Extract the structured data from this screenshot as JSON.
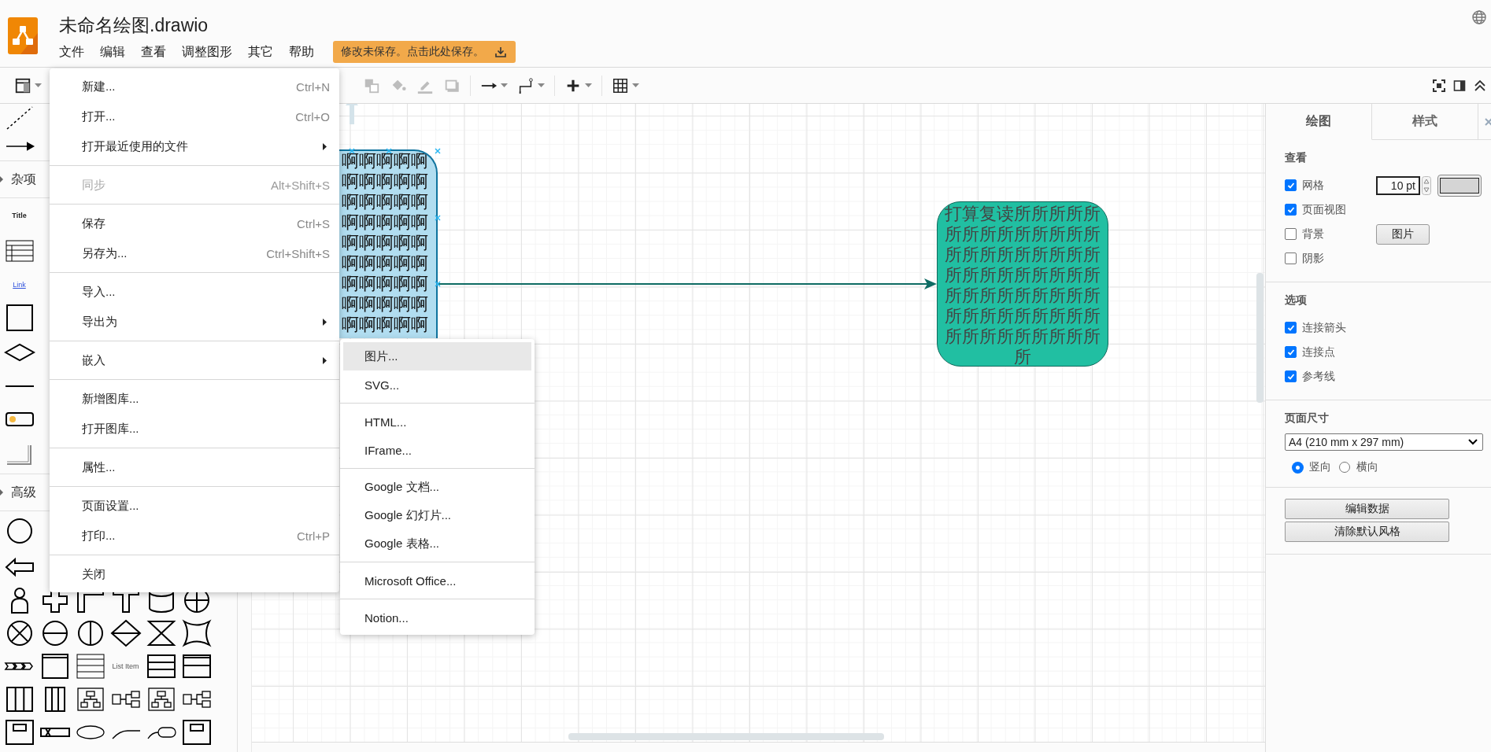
{
  "header": {
    "title": "未命名绘图.drawio",
    "menus": [
      "文件",
      "编辑",
      "查看",
      "调整图形",
      "其它",
      "帮助"
    ],
    "save_notice": "修改未保存。点击此处保存。"
  },
  "toolbar": [
    {
      "kind": "layout",
      "disabled": false
    },
    {
      "kind": "to-back",
      "disabled": true
    },
    {
      "kind": "fill",
      "disabled": true
    },
    {
      "kind": "line-color",
      "disabled": true
    },
    {
      "kind": "shadow",
      "disabled": true
    },
    {
      "kind": "separator"
    },
    {
      "kind": "connection",
      "disabled": false
    },
    {
      "kind": "waypoints",
      "disabled": false
    },
    {
      "kind": "separator"
    },
    {
      "kind": "insert",
      "disabled": false
    },
    {
      "kind": "separator"
    },
    {
      "kind": "table",
      "disabled": false
    }
  ],
  "file_menu": [
    {
      "kind": "item",
      "label": "新建...",
      "shortcut": "Ctrl+N",
      "disabled": false,
      "submenu": false
    },
    {
      "kind": "item",
      "label": "打开...",
      "shortcut": "Ctrl+O",
      "disabled": false,
      "submenu": false
    },
    {
      "kind": "item",
      "label": "打开最近使用的文件",
      "disabled": false,
      "submenu": true
    },
    {
      "kind": "separator"
    },
    {
      "kind": "item",
      "label": "同步",
      "shortcut": "Alt+Shift+S",
      "disabled": true,
      "submenu": false
    },
    {
      "kind": "separator"
    },
    {
      "kind": "item",
      "label": "保存",
      "shortcut": "Ctrl+S",
      "disabled": false,
      "submenu": false
    },
    {
      "kind": "item",
      "label": "另存为...",
      "shortcut": "Ctrl+Shift+S",
      "disabled": false,
      "submenu": false
    },
    {
      "kind": "separator"
    },
    {
      "kind": "item",
      "label": "导入...",
      "disabled": false,
      "submenu": false
    },
    {
      "kind": "item",
      "label": "导出为",
      "disabled": false,
      "submenu": true
    },
    {
      "kind": "separator"
    },
    {
      "kind": "item",
      "label": "嵌入",
      "disabled": false,
      "submenu": true
    },
    {
      "kind": "separator"
    },
    {
      "kind": "item",
      "label": "新增图库...",
      "disabled": false,
      "submenu": false
    },
    {
      "kind": "item",
      "label": "打开图库...",
      "disabled": false,
      "submenu": false
    },
    {
      "kind": "separator"
    },
    {
      "kind": "item",
      "label": "属性...",
      "disabled": false,
      "submenu": false
    },
    {
      "kind": "separator"
    },
    {
      "kind": "item",
      "label": "页面设置...",
      "disabled": false,
      "submenu": false
    },
    {
      "kind": "item",
      "label": "打印...",
      "shortcut": "Ctrl+P",
      "disabled": false,
      "submenu": false
    },
    {
      "kind": "separator"
    },
    {
      "kind": "item",
      "label": "关闭",
      "disabled": false,
      "submenu": false
    }
  ],
  "embed_submenu": [
    {
      "kind": "item",
      "label": "图片...",
      "selected": true
    },
    {
      "kind": "item",
      "label": "SVG...",
      "selected": false
    },
    {
      "kind": "separator"
    },
    {
      "kind": "item",
      "label": "HTML...",
      "selected": false
    },
    {
      "kind": "item",
      "label": "IFrame...",
      "selected": false
    },
    {
      "kind": "separator"
    },
    {
      "kind": "item",
      "label": "Google 文档...",
      "selected": false
    },
    {
      "kind": "item",
      "label": "Google 幻灯片...",
      "selected": false
    },
    {
      "kind": "item",
      "label": "Google 表格...",
      "selected": false
    },
    {
      "kind": "separator"
    },
    {
      "kind": "item",
      "label": "Microsoft Office...",
      "selected": false
    },
    {
      "kind": "separator"
    },
    {
      "kind": "item",
      "label": "Notion...",
      "selected": false
    }
  ],
  "sidebar": {
    "sections": [
      "杂项",
      "高级"
    ],
    "palette_labels": [
      "Title",
      "Link",
      "List Item"
    ]
  },
  "canvas": {
    "shapes": [
      {
        "kind": "process",
        "selected": true,
        "text": "啊啊啊啊啊啊啊啊啊啊啊啊啊啊啊啊啊啊啊啊啊啊啊啊啊啊啊啊啊啊啊啊啊啊啊啊啊啊啊啊啊啊啊啊啊"
      },
      {
        "kind": "rounded",
        "selected": false,
        "text": "打算复读所所所所所所所所所所所所所所所所所所所所所所所所所所所所所所所所所所所所所所所所所所所所所所所所所所所所所所所所所所所所"
      }
    ]
  },
  "format_panel": {
    "tabs": [
      {
        "label": "绘图",
        "selected": true
      },
      {
        "label": "样式",
        "selected": false
      }
    ],
    "view": {
      "title": "查看",
      "options": [
        {
          "label": "网格",
          "checked": true
        },
        {
          "label": "页面视图",
          "checked": true
        },
        {
          "label": "背景",
          "checked": false
        },
        {
          "label": "阴影",
          "checked": false
        }
      ],
      "grid_size": "10 pt",
      "image_button": "图片"
    },
    "options": {
      "title": "选项",
      "options": [
        {
          "label": "连接箭头",
          "checked": true
        },
        {
          "label": "连接点",
          "checked": true
        },
        {
          "label": "参考线",
          "checked": true
        }
      ]
    },
    "page_size": {
      "title": "页面尺寸",
      "value": "A4 (210 mm x 297 mm)",
      "orientations": [
        {
          "label": "竖向",
          "selected": true
        },
        {
          "label": "横向",
          "selected": false
        }
      ]
    },
    "buttons": [
      "编辑数据",
      "清除默认风格"
    ]
  }
}
